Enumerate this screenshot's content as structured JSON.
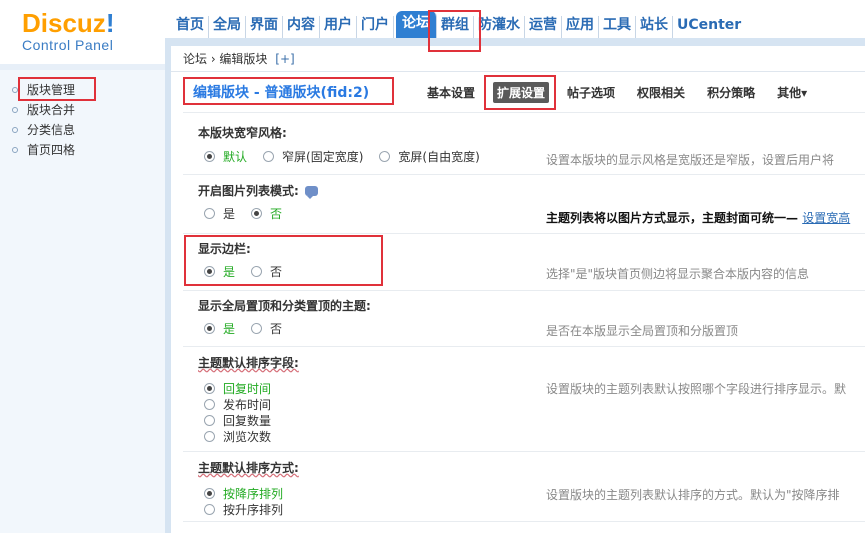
{
  "logo": {
    "brand_a": "Discuz",
    "brand_b": "!",
    "sub": "Control Panel"
  },
  "nav": [
    {
      "label": "首页"
    },
    {
      "label": "全局"
    },
    {
      "label": "界面"
    },
    {
      "label": "内容"
    },
    {
      "label": "用户"
    },
    {
      "label": "门户"
    },
    {
      "label": "论坛",
      "active": true
    },
    {
      "label": "群组"
    },
    {
      "label": "防灌水"
    },
    {
      "label": "运营"
    },
    {
      "label": "应用"
    },
    {
      "label": "工具"
    },
    {
      "label": "站长"
    },
    {
      "label": "UCenter"
    }
  ],
  "breadcrumb": {
    "path": "论坛 › 编辑版块",
    "plus": "[+]"
  },
  "sidebar": {
    "items": [
      {
        "label": "版块管理"
      },
      {
        "label": "版块合并"
      },
      {
        "label": "分类信息"
      },
      {
        "label": "首页四格"
      }
    ]
  },
  "main": {
    "title": "编辑版块 - 普通版块(fid:2)",
    "tabs": [
      "基本设置",
      "扩展设置",
      "帖子选项",
      "权限相关",
      "积分策略",
      "其他▾"
    ]
  },
  "sections": {
    "width_style": {
      "label": "本版块宽窄风格:",
      "options": [
        "默认",
        "窄屏(固定宽度)",
        "宽屏(自由宽度)"
      ],
      "desc": "设置本版块的显示风格是宽版还是窄版，设置后用户将"
    },
    "image_list": {
      "label": "开启图片列表模式:",
      "options": [
        "是",
        "否"
      ],
      "desc": "主题列表将以图片方式显示，主题封面可统一— ",
      "desc_link": "设置宽高"
    },
    "sidebar_show": {
      "label": "显示边栏:",
      "options": [
        "是",
        "否"
      ],
      "desc": "选择\"是\"版块首页侧边将显示聚合本版内容的信息"
    },
    "sticky_show": {
      "label": "显示全局置顶和分类置顶的主题:",
      "options": [
        "是",
        "否"
      ],
      "desc": "是否在本版显示全局置顶和分版置顶"
    },
    "sort_field": {
      "label": "主题默认排序字段:",
      "options": [
        "回复时间",
        "发布时间",
        "回复数量",
        "浏览次数"
      ],
      "desc": "设置版块的主题列表默认按照哪个字段进行排序显示。默"
    },
    "sort_order": {
      "label": "主题默认排序方式:",
      "options": [
        "按降序排列",
        "按升序排列"
      ],
      "desc": "设置版块的主题列表默认排序的方式。默认为\"按降序排"
    }
  }
}
